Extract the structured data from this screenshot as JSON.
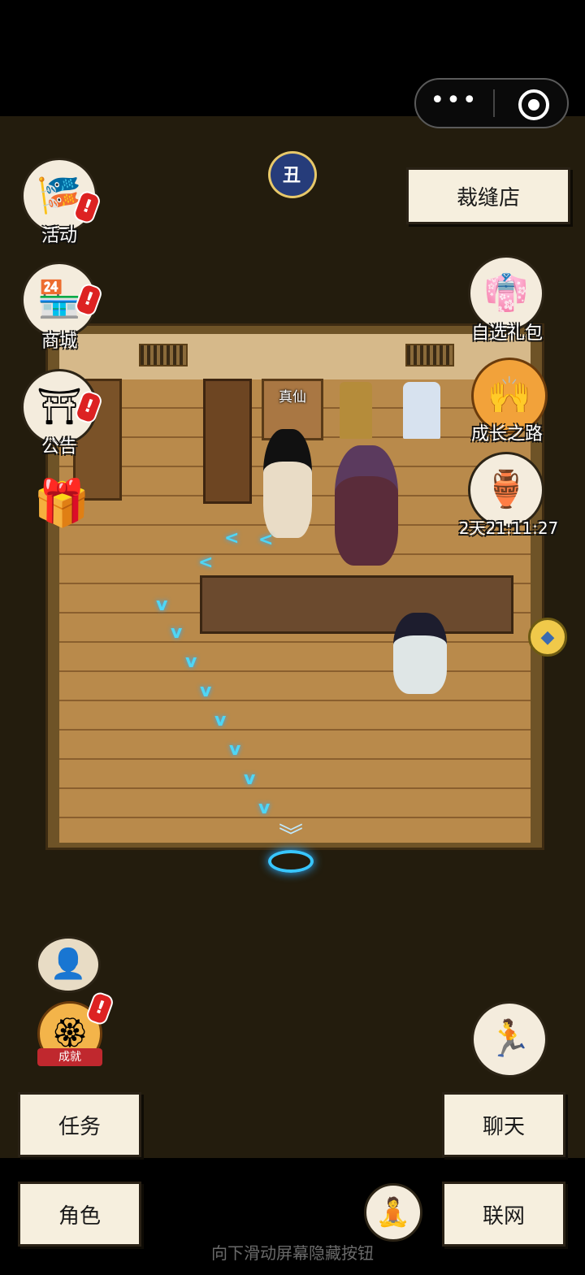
{
  "status_bar": {
    "menu_dots": "•••",
    "capsule_target_icon": "target-icon"
  },
  "header": {
    "time_badge": "丑",
    "location_sign": "裁缝店"
  },
  "left_menu": [
    {
      "id": "activity",
      "label": "活动",
      "icon": "flag-scroll-icon",
      "alert": "!"
    },
    {
      "id": "shop",
      "label": "商城",
      "icon": "store-icon",
      "store_sign": "杂货",
      "alert": "!"
    },
    {
      "id": "notice",
      "label": "公告",
      "icon": "notice-board-icon",
      "alert": "!"
    },
    {
      "id": "gift",
      "label": "",
      "icon": "gift-box-icon"
    }
  ],
  "right_menu": [
    {
      "id": "pick_gift",
      "label": "自选礼包",
      "icon": "dress-gift-icon"
    },
    {
      "id": "growth",
      "label": "成长之路",
      "icon": "growth-emblem-icon"
    },
    {
      "id": "timer_event",
      "label": "2天21:11:27",
      "icon": "bronze-censer-icon"
    }
  ],
  "scene": {
    "drawer_label": "真仙",
    "map_pin_icon": "diamond-pin-icon",
    "path_arrows": [
      "<",
      "<",
      "<",
      "v",
      "v",
      "v",
      "v",
      "v",
      "v",
      "v",
      "v"
    ],
    "exit_chevron": "︾"
  },
  "bottom_left": {
    "master_icon": "hat-silhouette-icon",
    "achievement_label": "成就",
    "achievement_alert": "!"
  },
  "bottom_right": {
    "run_icon": "running-man-icon"
  },
  "buttons": {
    "tasks": "任务",
    "chat": "聊天",
    "character": "角色",
    "network": "联网"
  },
  "meditate_icon": "meditation-icon",
  "hint_text": "向下滑动屏幕隐藏按钮"
}
